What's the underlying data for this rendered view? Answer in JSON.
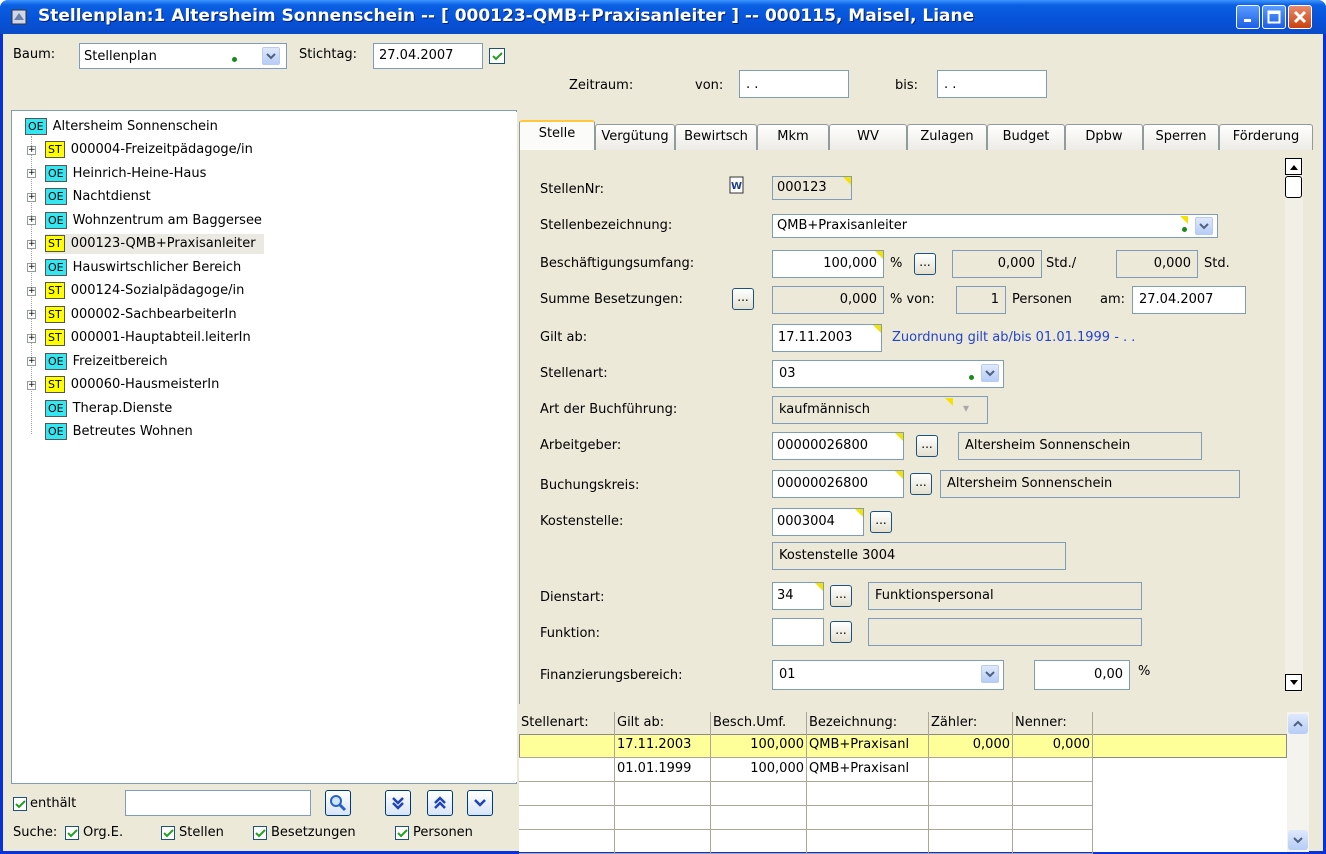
{
  "window": {
    "title": "Stellenplan:1  Altersheim Sonnenschein -- [ 000123-QMB+Praxisanleiter ] -- 000115, Maisel, Liane"
  },
  "toolbar": {
    "baum_label": "Baum:",
    "baum_value": "Stellenplan",
    "stichtag_label": "Stichtag:",
    "stichtag_value": "27.04.2007",
    "zeitraum_label": "Zeitraum:",
    "von_label": "von:",
    "von_value": " .  .",
    "bis_label": "bis:",
    "bis_value": " .  ."
  },
  "tree": [
    {
      "tag": "OE",
      "label": "Altersheim Sonnenschein"
    },
    {
      "tag": "ST",
      "label": "000004-Freizeitpädagoge/in"
    },
    {
      "tag": "OE",
      "label": "Heinrich-Heine-Haus"
    },
    {
      "tag": "OE",
      "label": "Nachtdienst"
    },
    {
      "tag": "OE",
      "label": "Wohnzentrum  am Baggersee"
    },
    {
      "tag": "ST",
      "label": "000123-QMB+Praxisanleiter"
    },
    {
      "tag": "OE",
      "label": "Hauswirtschlicher Bereich"
    },
    {
      "tag": "ST",
      "label": "000124-Sozialpädagoge/in"
    },
    {
      "tag": "ST",
      "label": "000002-SachbearbeiterIn"
    },
    {
      "tag": "ST",
      "label": "000001-Hauptabteil.leiterIn"
    },
    {
      "tag": "OE",
      "label": "Freizeitbereich"
    },
    {
      "tag": "ST",
      "label": "000060-HausmeisterIn"
    },
    {
      "tag": "OE",
      "label": "Therap.Dienste"
    },
    {
      "tag": "OE",
      "label": "Betreutes Wohnen"
    }
  ],
  "search": {
    "enthaelt_label": "enthält",
    "value": "",
    "suche_label": "Suche:",
    "org_label": "Org.E.",
    "stellen_label": "Stellen",
    "besetzungen_label": "Besetzungen",
    "personen_label": "Personen"
  },
  "tabs": [
    "Stelle",
    "Vergütung",
    "Bewirtsch",
    "Mkm",
    "WV",
    "Zulagen",
    "Budget",
    "Dpbw",
    "Sperren",
    "Förderung"
  ],
  "form": {
    "stellennr_label": "StellenNr:",
    "stellennr": "000123",
    "bez_label": "Stellenbezeichnung:",
    "bez": "QMB+Praxisanleiter",
    "umfang_label": "Beschäftigungsumfang:",
    "umfang": "100,000",
    "pct": "%",
    "std1": "0,000",
    "std_label": "Std./",
    "std2": "0,000",
    "std_label2": "Std.",
    "summe_label": "Summe Besetzungen:",
    "summe": "0,000",
    "summe_von": "% von:",
    "personen": "1",
    "personen_label": "Personen",
    "am_label": "am:",
    "am": "27.04.2007",
    "gilt_label": "Gilt ab:",
    "gilt": "17.11.2003",
    "zuordnung": "Zuordnung gilt ab/bis 01.01.1999 -  .  .",
    "art_label": "Stellenart:",
    "art": "03",
    "buch_label": "Art der Buchführung:",
    "buch": "kaufmännisch",
    "ag_label": "Arbeitgeber:",
    "ag": "00000026800",
    "ag_name": "Altersheim Sonnenschein",
    "bk_label": "Buchungskreis:",
    "bk": "00000026800",
    "bk_name": "Altersheim Sonnenschein",
    "ks_label": "Kostenstelle:",
    "ks": "0003004",
    "ks_name": "Kostenstelle 3004",
    "da_label": "Dienstart:",
    "da": "34",
    "da_name": "Funktionspersonal",
    "fk_label": "Funktion:",
    "fk": "",
    "fk_name": "",
    "fin_label": "Finanzierungsbereich:",
    "fin": "01",
    "fin_pct": "0,00",
    "fin_pct_sign": "%"
  },
  "grid": {
    "headers": [
      "Stellenart:",
      "Gilt ab:",
      "Besch.Umf.",
      "Bezeichnung:",
      "Zähler:",
      "Nenner:"
    ],
    "rows": [
      [
        "",
        "17.11.2003",
        "100,000",
        "QMB+Praxisanl",
        "0,000",
        "0,000"
      ],
      [
        "",
        "01.01.1999",
        "100,000",
        "QMB+Praxisanl",
        "",
        ""
      ]
    ]
  },
  "colors": {
    "titlebar": "#0a5fe3",
    "oe_tag": "#33e6f0",
    "st_tag": "#ffff00",
    "selected_row": "#ffff99",
    "link": "#2244cc"
  }
}
